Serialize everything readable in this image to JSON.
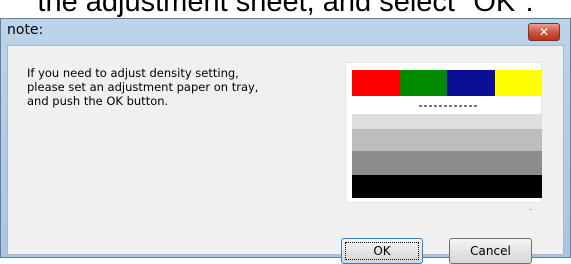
{
  "caption": {
    "text": "the adjustment sheet, and select \"OK\"."
  },
  "window": {
    "title": "note:",
    "close_symbol": "✕",
    "close_icon": "close-icon"
  },
  "message": {
    "lines": [
      "If you need to adjust density setting,",
      "please set an adjustment paper on tray,",
      "and push the OK button."
    ]
  },
  "adjustment_sheet": {
    "color_patches": [
      "#ff0000",
      "#008a00",
      "#0a1096",
      "#ffff00"
    ],
    "gray_bands": [
      "#dedede",
      "#bdbdbd",
      "#8c8c8c",
      "#000000"
    ]
  },
  "buttons": {
    "ok": "OK",
    "cancel": "Cancel"
  }
}
